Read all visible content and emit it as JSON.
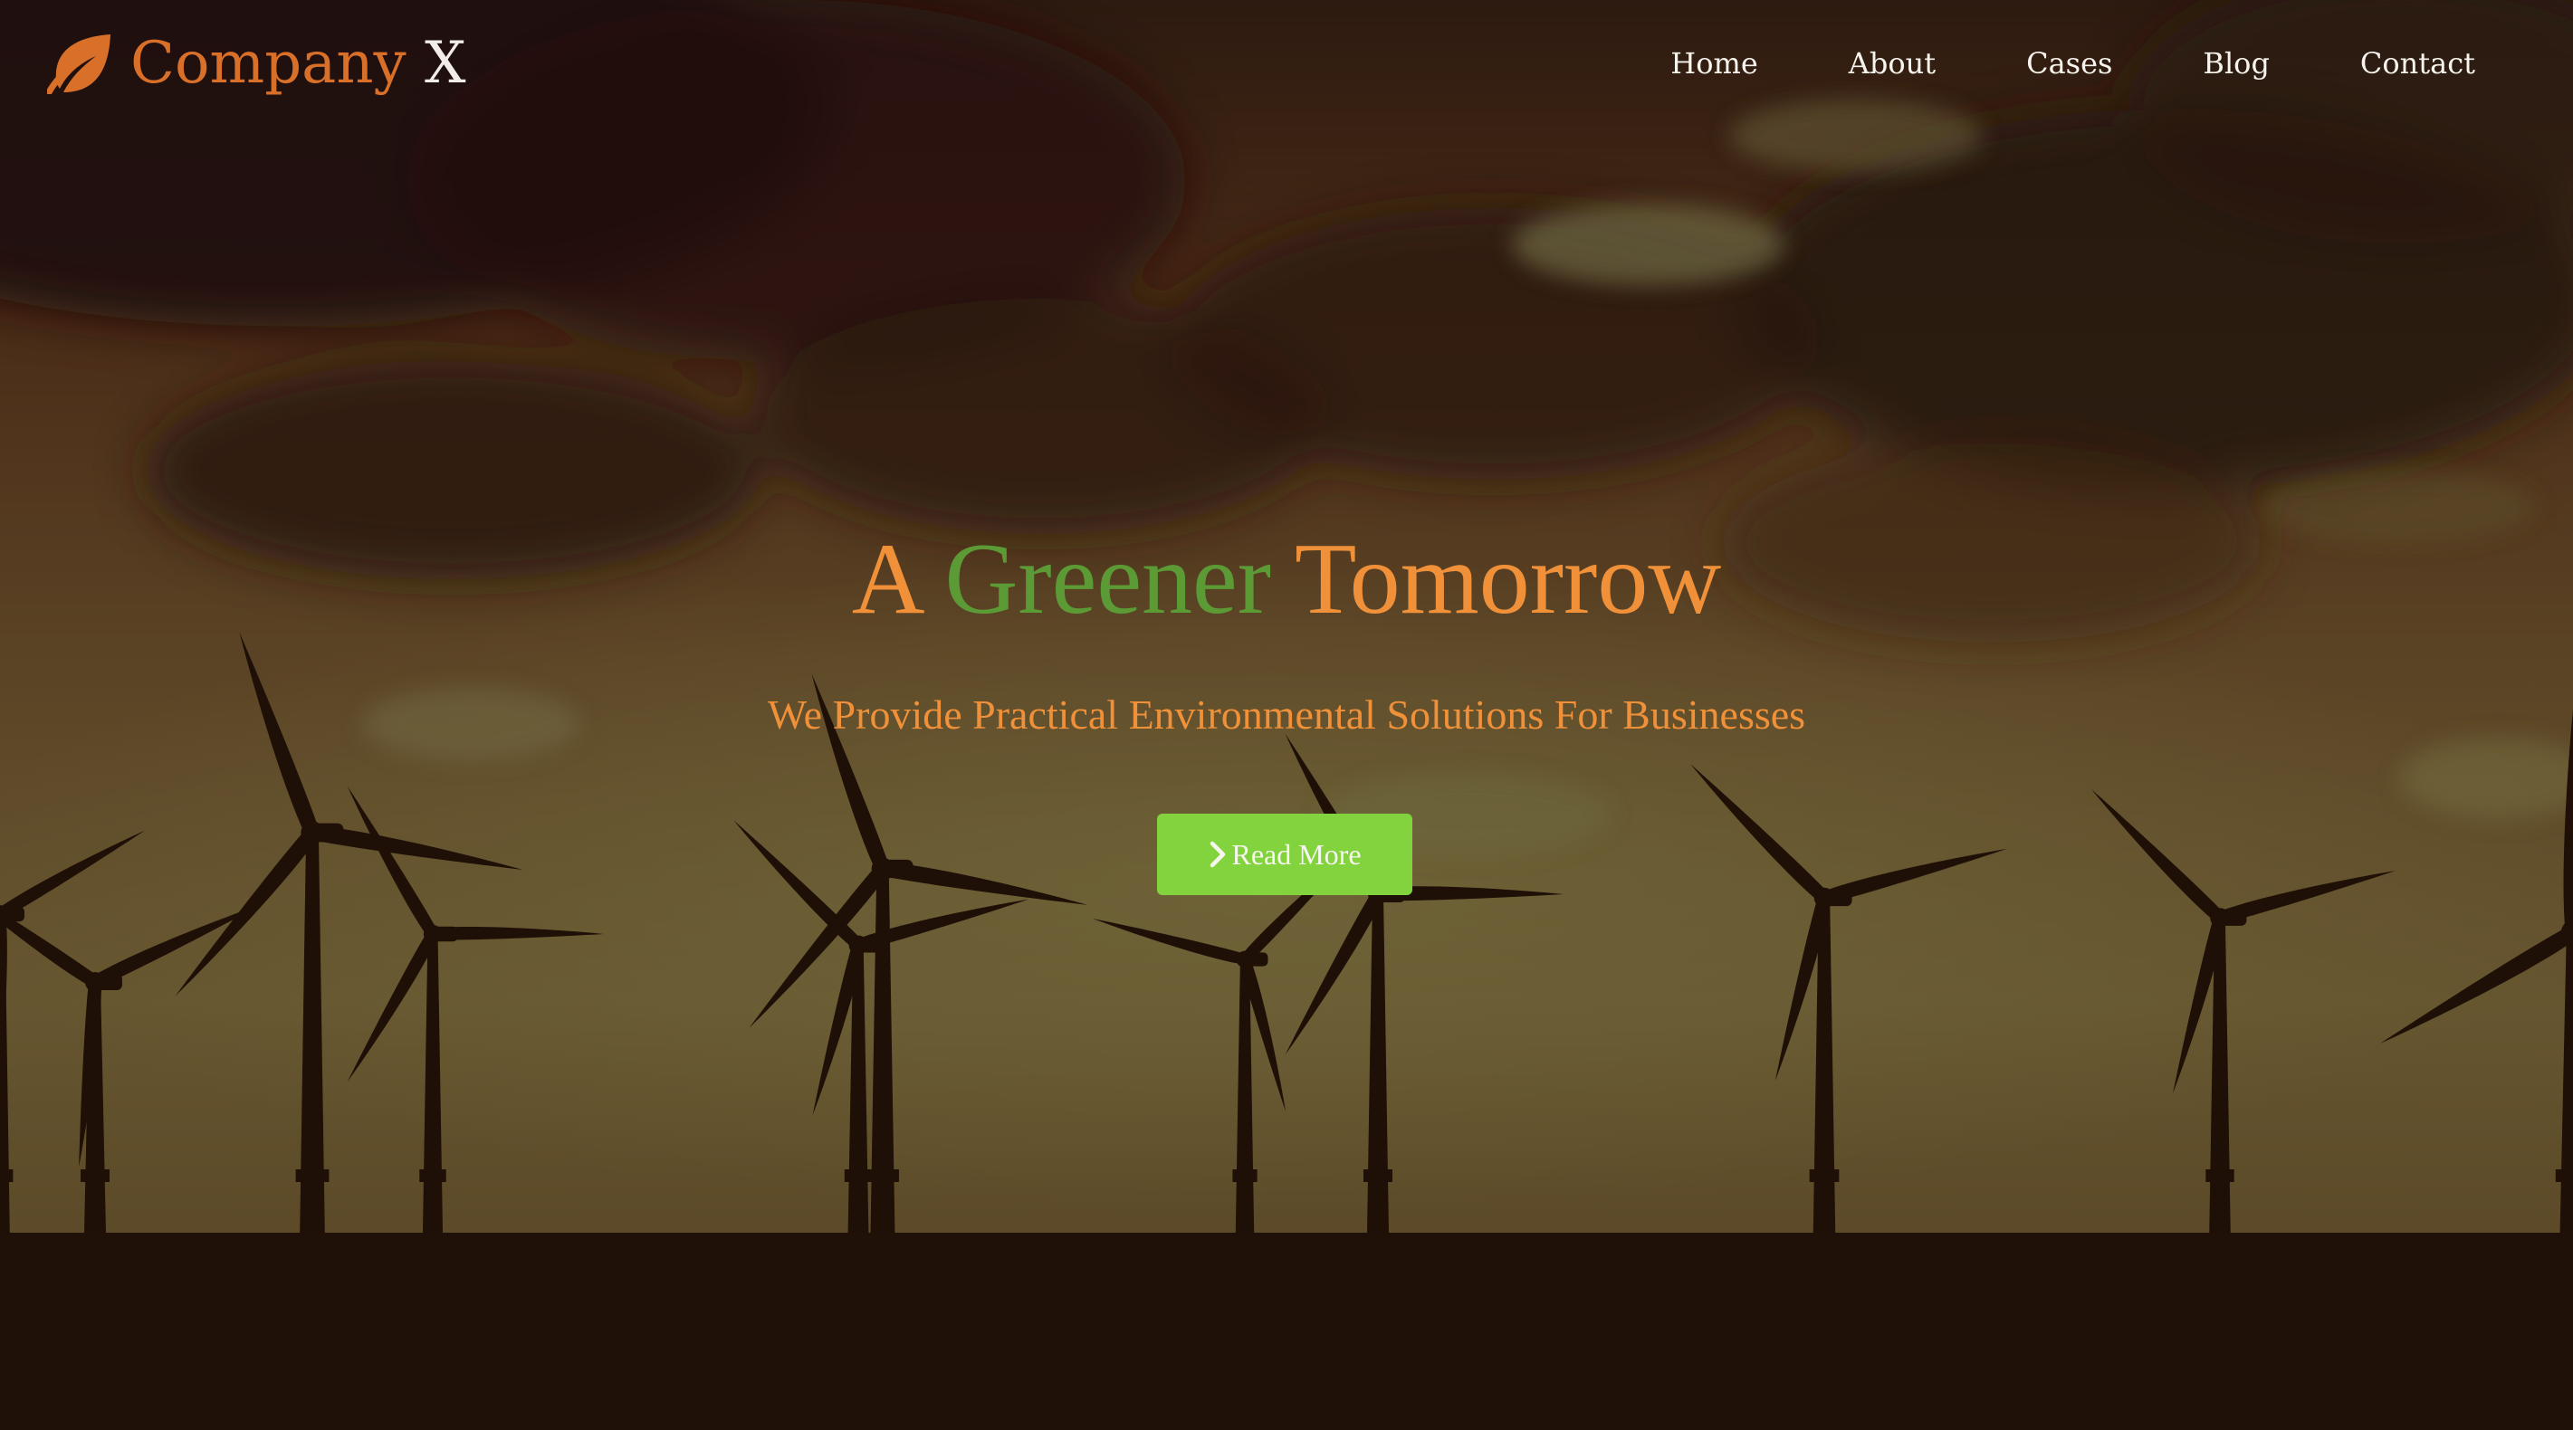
{
  "brand": {
    "name": "Company",
    "mark": "X",
    "logo_icon": "leaf-icon",
    "color": "#d9702a"
  },
  "nav": {
    "items": [
      {
        "label": "Home"
      },
      {
        "label": "About"
      },
      {
        "label": "Cases"
      },
      {
        "label": "Blog"
      },
      {
        "label": "Contact"
      }
    ]
  },
  "hero": {
    "title_part1": "A ",
    "title_highlight": "Greener",
    "title_part2": " Tomorrow",
    "subtitle": "We Provide Practical Environmental Solutions For Businesses",
    "cta_label": "Read More",
    "cta_icon": "chevron-right-icon",
    "background": "wind-turbines-silhouette-sunset"
  },
  "colors": {
    "accent_orange": "#f0913a",
    "accent_green": "#5c9a35",
    "button_green": "#83d33f",
    "ground": "#1f1108"
  }
}
